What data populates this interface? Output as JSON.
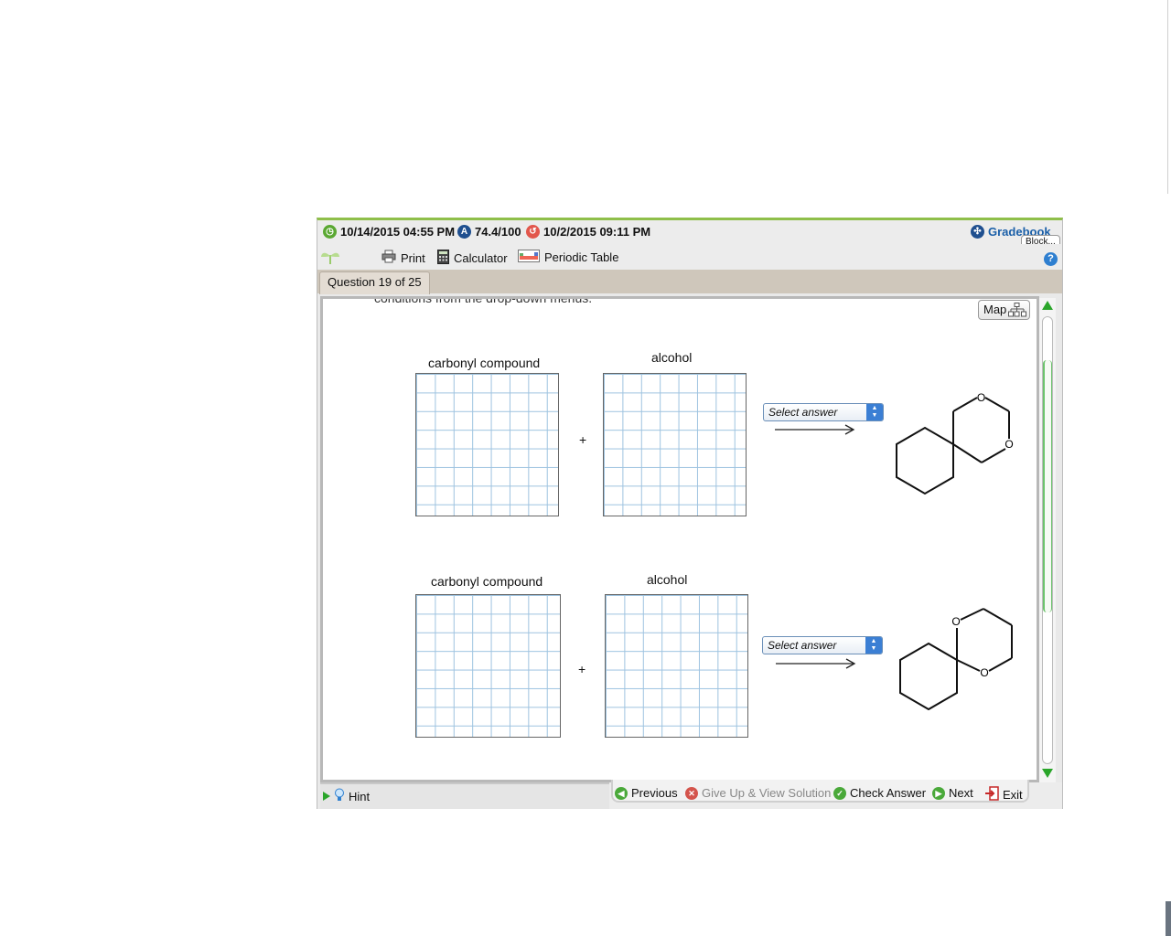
{
  "status": {
    "due_date": "10/14/2015 04:55 PM",
    "score": "74.4/100",
    "last_date": "10/2/2015 09:11 PM",
    "gradebook_label": "Gradebook",
    "block_label": "Block..."
  },
  "toolbar": {
    "print_label": "Print",
    "calculator_label": "Calculator",
    "periodic_table_label": "Periodic Table"
  },
  "tab": {
    "label": "Question 19 of 25"
  },
  "question": {
    "clipped_text": "conditions from the drop-down menus.",
    "map_label": "Map",
    "row1": {
      "carbonyl_label": "carbonyl compound",
      "alcohol_label": "alcohol",
      "plus": "+",
      "select_placeholder": "Select answer",
      "product_atom_1": "O",
      "product_atom_2": "O"
    },
    "row2": {
      "carbonyl_label": "carbonyl compound",
      "alcohol_label": "alcohol",
      "plus": "+",
      "select_placeholder": "Select answer",
      "product_atom_1": "O",
      "product_atom_2": "O"
    }
  },
  "bottom": {
    "hint_label": "Hint",
    "previous_label": "Previous",
    "giveup_label": "Give Up & View Solution",
    "check_label": "Check Answer",
    "next_label": "Next",
    "exit_label": "Exit"
  },
  "colors": {
    "accent_green": "#8fbf4a",
    "link_blue": "#1a5fa8",
    "grid_blue": "#9ec3e0"
  }
}
